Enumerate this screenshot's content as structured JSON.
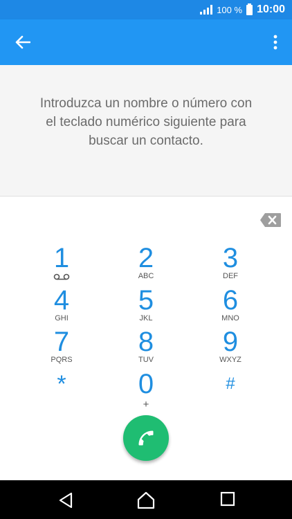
{
  "status_bar": {
    "battery_percent": "100 %",
    "time": "10:00"
  },
  "app_bar": {
    "back_icon": "arrow-back-icon",
    "menu_icon": "more-vert-icon"
  },
  "hint": {
    "text": "Introduzca un nombre o número con el teclado numérico siguiente para buscar un contacto."
  },
  "keypad": {
    "keys": [
      {
        "digit": "1",
        "letters": ""
      },
      {
        "digit": "2",
        "letters": "ABC"
      },
      {
        "digit": "3",
        "letters": "DEF"
      },
      {
        "digit": "4",
        "letters": "GHI"
      },
      {
        "digit": "5",
        "letters": "JKL"
      },
      {
        "digit": "6",
        "letters": "MNO"
      },
      {
        "digit": "7",
        "letters": "PQRS"
      },
      {
        "digit": "8",
        "letters": "TUV"
      },
      {
        "digit": "9",
        "letters": "WXYZ"
      },
      {
        "digit": "*",
        "letters": ""
      },
      {
        "digit": "0",
        "letters": "+"
      },
      {
        "digit": "#",
        "letters": ""
      }
    ]
  },
  "colors": {
    "accent": "#2196f3",
    "status": "#1e88e5",
    "digit": "#1f8ee0",
    "call": "#1fbd72"
  }
}
